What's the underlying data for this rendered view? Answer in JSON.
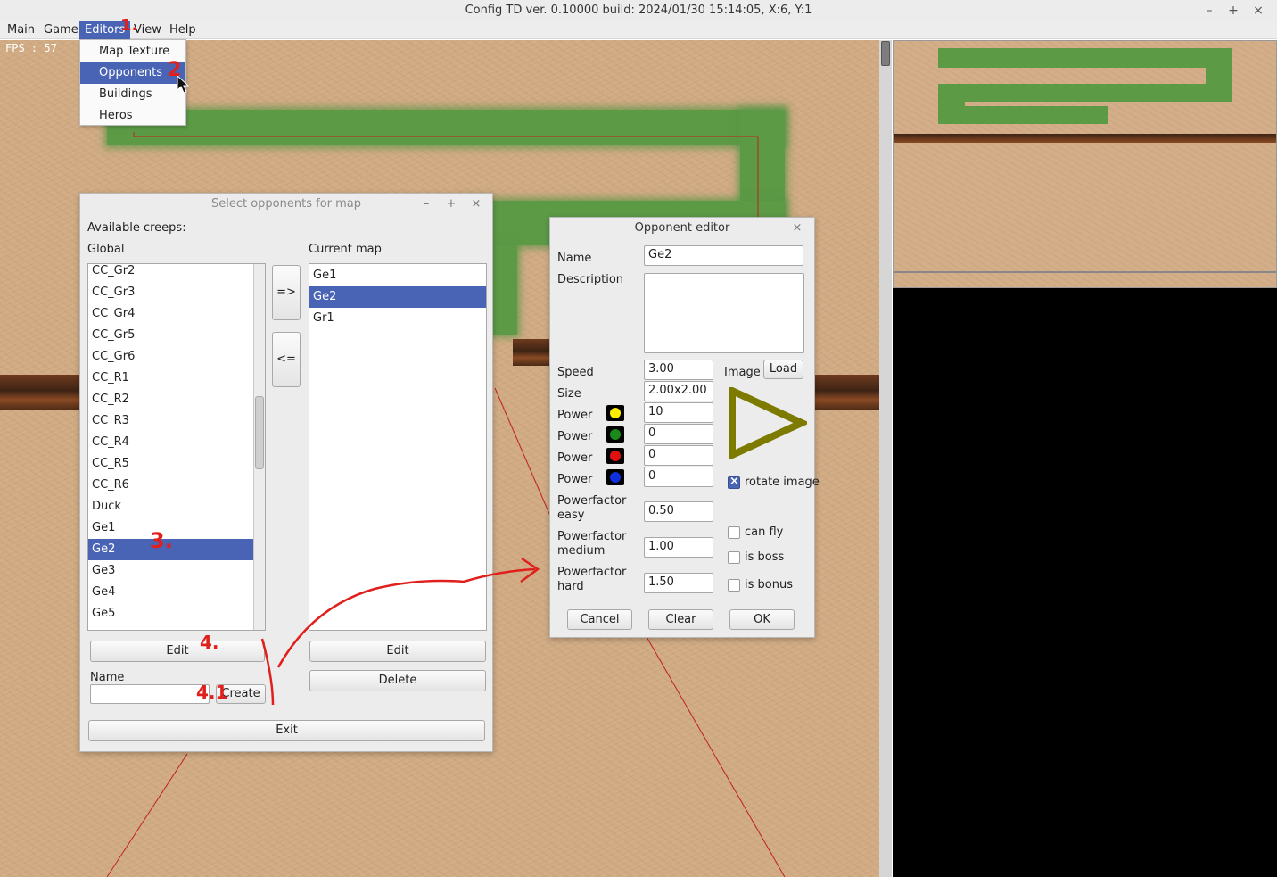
{
  "window": {
    "title": "Config TD ver. 0.10000 build: 2024/01/30  15:14:05, X:6, Y:1",
    "minimize": "–",
    "maximize": "+",
    "close": "×"
  },
  "menubar": {
    "items": [
      "Main",
      "Game",
      "Editors",
      "View",
      "Help"
    ],
    "editors_menu": [
      "Map Texture",
      "Opponents",
      "Buildings",
      "Heros"
    ]
  },
  "game": {
    "fps": "FPS : 57"
  },
  "select_dialog": {
    "title": "Select opponents for map",
    "minimize": "–",
    "maximize": "+",
    "close": "×",
    "available_label": "Available creeps:",
    "global_label": "Global",
    "current_label": "Current map",
    "global_list": [
      "CC_Gr2",
      "CC_Gr3",
      "CC_Gr4",
      "CC_Gr5",
      "CC_Gr6",
      "CC_R1",
      "CC_R2",
      "CC_R3",
      "CC_R4",
      "CC_R5",
      "CC_R6",
      "Duck",
      "Ge1",
      "Ge2",
      "Ge3",
      "Ge4",
      "Ge5"
    ],
    "current_list": [
      "Ge1",
      "Ge2",
      "Gr1"
    ],
    "add_button": "=>",
    "remove_button": "<=",
    "edit_global": "Edit",
    "edit_current": "Edit",
    "delete": "Delete",
    "name_label": "Name",
    "name_value": "",
    "create": "Create",
    "exit": "Exit"
  },
  "opponent_editor": {
    "title": "Opponent editor",
    "minimize": "–",
    "close": "×",
    "name_label": "Name",
    "name_value": "Ge2",
    "description_label": "Description",
    "description_value": "",
    "speed_label": "Speed",
    "speed_value": "3.00",
    "size_label": "Size",
    "size_value": "2.00x2.00",
    "image_label": "Image",
    "load": "Load",
    "powers": [
      {
        "label": "Power",
        "color": "#ffee00",
        "value": "10"
      },
      {
        "label": "Power",
        "color": "#1a8a1a",
        "value": "0"
      },
      {
        "label": "Power",
        "color": "#e01010",
        "value": "0"
      },
      {
        "label": "Power",
        "color": "#1030e0",
        "value": "0"
      }
    ],
    "pf_easy_label_1": "Powerfactor",
    "pf_easy_label_2": "easy",
    "pf_easy_value": "0.50",
    "pf_medium_label_1": "Powerfactor",
    "pf_medium_label_2": "medium",
    "pf_medium_value": "1.00",
    "pf_hard_label_1": "Powerfactor",
    "pf_hard_label_2": "hard",
    "pf_hard_value": "1.50",
    "rotate_image": "rotate image",
    "rotate_checked": true,
    "can_fly": "can fly",
    "is_boss": "is boss",
    "is_bonus": "is bonus",
    "cancel": "Cancel",
    "clear": "Clear",
    "ok": "OK",
    "sprite_color": "#7d7a00"
  },
  "annotations": {
    "a1": "1.",
    "a2": "2",
    "a3": "3.",
    "a4": "4.",
    "a41": "4.1"
  }
}
